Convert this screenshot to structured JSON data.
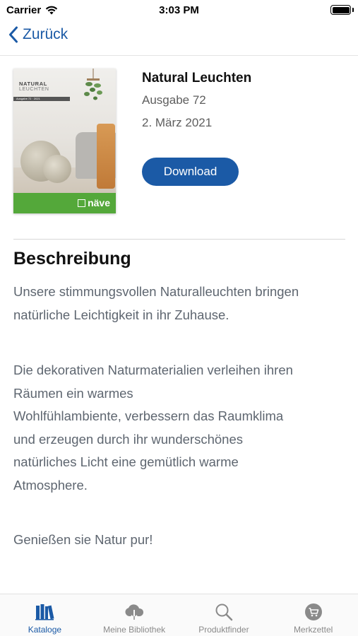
{
  "status_bar": {
    "carrier": "Carrier",
    "time": "3:03 PM"
  },
  "nav": {
    "back_label": "Zurück"
  },
  "catalog": {
    "title": "Natural Leuchten",
    "edition": "Ausgabe 72",
    "date": "2. März 2021",
    "download_label": "Download",
    "cover": {
      "title": "NATURAL",
      "subtitle": "LEUCHTEN",
      "strip_text": "Ausgabe 72 · 2021",
      "brand": "näve"
    }
  },
  "description": {
    "heading": "Beschreibung",
    "paragraph_1": "Unsere stimmungsvollen Naturalleuchten bringen natürliche Leichtigkeit in ihr Zuhause.",
    "paragraph_2_lines": [
      "Die dekorativen Naturmaterialien verleihen ihren",
      "Räumen ein warmes",
      "Wohlfühlambiente, verbessern das Raumklima",
      "und erzeugen durch ihr wunderschönes",
      "natürliches Licht eine gemütlich warme",
      "Atmosphere."
    ],
    "paragraph_3": "Genießen sie Natur pur!"
  },
  "tab_bar": {
    "tabs": [
      {
        "label": "Kataloge",
        "icon": "books-icon",
        "active": true
      },
      {
        "label": "Meine Bibliothek",
        "icon": "cloud-download-icon",
        "active": false
      },
      {
        "label": "Produktfinder",
        "icon": "search-icon",
        "active": false
      },
      {
        "label": "Merkzettel",
        "icon": "cart-icon",
        "active": false
      }
    ]
  },
  "colors": {
    "accent": "#1b5aa6",
    "text_secondary": "#5e6670",
    "cover_green": "#54a83a"
  }
}
